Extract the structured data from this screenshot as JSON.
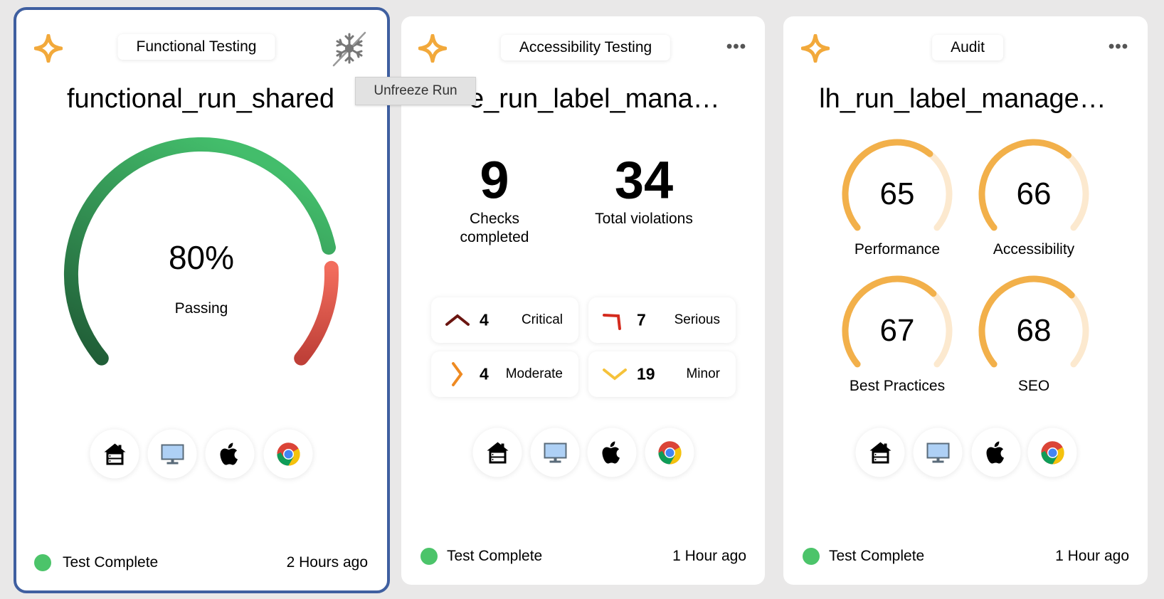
{
  "colors": {
    "selected_border": "#3f5fa0",
    "status_complete": "#4cc46a",
    "passing_green_dark": "#1f5a35",
    "passing_green_light": "#43bd6b",
    "failing_red_light": "#f26d5d",
    "failing_red_dark": "#bf4038",
    "audit_fill": "#f2b04a",
    "audit_track": "#fce9cf",
    "sparkle": "#f2a93b"
  },
  "tooltip": "Unfreeze Run",
  "cards": [
    {
      "type_label": "Functional Testing",
      "corner_icon": "snowflake-off-icon",
      "title": "functional_run_shared",
      "gauge": {
        "percent": 80,
        "value_label": "80%",
        "caption": "Passing"
      },
      "platform_icons": [
        "server-house-icon",
        "monitor-icon",
        "apple-icon",
        "chrome-icon"
      ],
      "status": "Test Complete",
      "time": "2 Hours ago"
    },
    {
      "type_label": "Accessibility Testing",
      "corner_icon": "more-icon",
      "title": "e_run_label_mana…",
      "checks_completed": {
        "value": "9",
        "label_line1": "Checks",
        "label_line2": "completed"
      },
      "total_violations": {
        "value": "34",
        "label": "Total violations"
      },
      "severities": [
        {
          "icon": "critical-chevron-up-icon",
          "count": "4",
          "label": "Critical",
          "color": "#6b1510"
        },
        {
          "icon": "serious-corner-icon",
          "count": "7",
          "label": "Serious",
          "color": "#d42b1e"
        },
        {
          "icon": "moderate-chevron-right-icon",
          "count": "4",
          "label": "Moderate",
          "color": "#ee8a22"
        },
        {
          "icon": "minor-chevron-down-icon",
          "count": "19",
          "label": "Minor",
          "color": "#f5c23a"
        }
      ],
      "platform_icons": [
        "server-house-icon",
        "monitor-icon",
        "apple-icon",
        "chrome-icon"
      ],
      "status": "Test Complete",
      "time": "1 Hour ago"
    },
    {
      "type_label": "Audit",
      "corner_icon": "more-icon",
      "title": "lh_run_label_manage…",
      "scores": [
        {
          "value": 65,
          "label": "Performance"
        },
        {
          "value": 66,
          "label": "Accessibility"
        },
        {
          "value": 67,
          "label": "Best Practices"
        },
        {
          "value": 68,
          "label": "SEO"
        }
      ],
      "platform_icons": [
        "server-house-icon",
        "monitor-icon",
        "apple-icon",
        "chrome-icon"
      ],
      "status": "Test Complete",
      "time": "1 Hour ago"
    }
  ]
}
